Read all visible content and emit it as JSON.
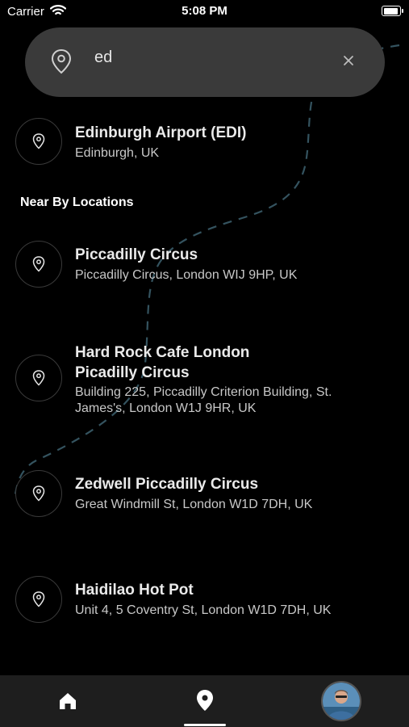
{
  "status": {
    "carrier": "Carrier",
    "time": "5:08 PM"
  },
  "search": {
    "query": "ed",
    "icon": "map-pin-icon",
    "clear_icon": "close-icon"
  },
  "top_result": {
    "title": "Edinburgh Airport (EDI)",
    "subtitle": "Edinburgh, UK"
  },
  "section_title": "Near By Locations",
  "nearby": [
    {
      "title": "Piccadilly Circus",
      "subtitle": "Piccadilly Circus, London WIJ 9HP, UK"
    },
    {
      "title": "Hard Rock Cafe London\nPicadilly Circus",
      "subtitle": "Building 225, Piccadilly Criterion Building, St. James's, London W1J 9HR, UK"
    },
    {
      "title": "Zedwell Piccadilly Circus",
      "subtitle": "Great Windmill St, London W1D 7DH, UK"
    },
    {
      "title": "Haidilao Hot Pot",
      "subtitle": "Unit 4, 5 Coventry St, London W1D 7DH, UK"
    }
  ],
  "tabbar": {
    "active_tab": "location",
    "icons": [
      "home-icon",
      "location-icon",
      "avatar"
    ]
  },
  "colors": {
    "background": "#000000",
    "search_bg": "#3a3a3a",
    "route": "#3a5a66",
    "tabbar": "#1e1e1e"
  }
}
